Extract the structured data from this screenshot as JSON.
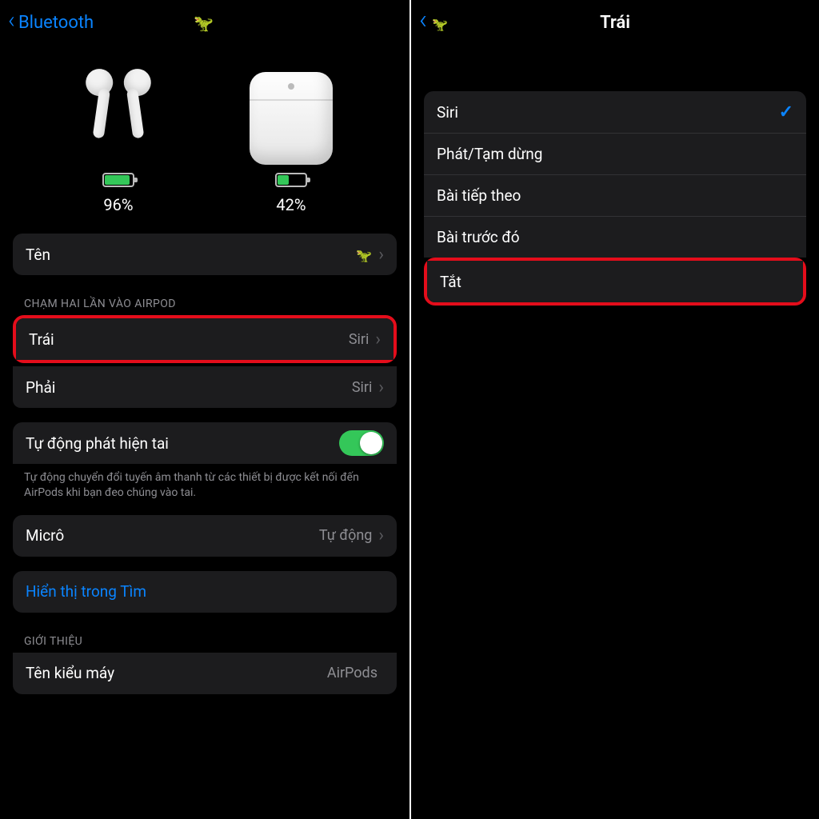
{
  "left": {
    "back_label": "Bluetooth",
    "airpods_pct": "96%",
    "case_pct": "42%",
    "airpods_fill_width": "86%",
    "case_fill_width": "38%",
    "name_row": {
      "label": "Tên"
    },
    "doubletap_header": "CHẠM HAI LẦN VÀO AIRPOD",
    "left_row": {
      "label": "Trái",
      "value": "Siri"
    },
    "right_row": {
      "label": "Phải",
      "value": "Siri"
    },
    "ear_detect": {
      "label": "Tự động phát hiện tai"
    },
    "ear_footer": "Tự động chuyển đổi tuyến âm thanh từ các thiết bị được kết nối đến AirPods khi bạn đeo chúng vào tai.",
    "mic_row": {
      "label": "Micrô",
      "value": "Tự động"
    },
    "find_row": {
      "label": "Hiển thị trong Tìm"
    },
    "about_header": "GIỚI THIỆU",
    "model_row": {
      "label": "Tên kiểu máy",
      "value": "AirPods"
    }
  },
  "right": {
    "title": "Trái",
    "options": {
      "siri": "Siri",
      "play": "Phát/Tạm dừng",
      "next": "Bài tiếp theo",
      "prev": "Bài trước đó",
      "off": "Tắt"
    }
  }
}
